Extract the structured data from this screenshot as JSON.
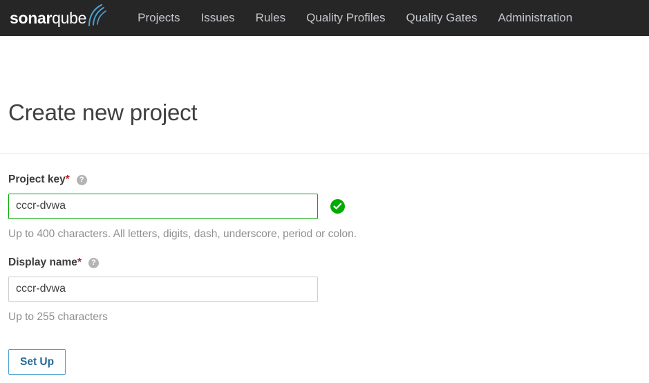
{
  "navbar": {
    "brand": {
      "name_bold": "sonar",
      "name_light": "qube",
      "arcs_icon": "sonar-waves-icon"
    },
    "items": [
      {
        "label": "Projects",
        "name": "nav-item-projects"
      },
      {
        "label": "Issues",
        "name": "nav-item-issues"
      },
      {
        "label": "Rules",
        "name": "nav-item-rules"
      },
      {
        "label": "Quality Profiles",
        "name": "nav-item-quality-profiles"
      },
      {
        "label": "Quality Gates",
        "name": "nav-item-quality-gates"
      },
      {
        "label": "Administration",
        "name": "nav-item-administration"
      }
    ]
  },
  "page": {
    "title": "Create new project"
  },
  "form": {
    "project_key": {
      "label": "Project key",
      "required_marker": "*",
      "help_icon": "?",
      "value": "cccr-dvwa",
      "placeholder": "",
      "note": "Up to 400 characters. All letters, digits, dash, underscore, period or colon.",
      "validation_state": "valid",
      "validation_icon": "check-circle-icon"
    },
    "display_name": {
      "label": "Display name",
      "required_marker": "*",
      "help_icon": "?",
      "value": "cccr-dvwa",
      "placeholder": "",
      "note": "Up to 255 characters",
      "validation_state": "none"
    },
    "submit_button": {
      "label": "Set Up"
    }
  },
  "colors": {
    "navbar_background": "#262626",
    "navbar_text": "#c3c6cc",
    "brand_arc": "#4b9fd5",
    "accent_blue": "#4b9fd5",
    "link_blue": "#236a97",
    "valid_green": "#00aa00",
    "required_red": "#bb2222",
    "heading_text": "#404040",
    "note_text": "#8f8f8f",
    "input_border": "#cdcdcd",
    "divider": "#e6e6e6"
  }
}
